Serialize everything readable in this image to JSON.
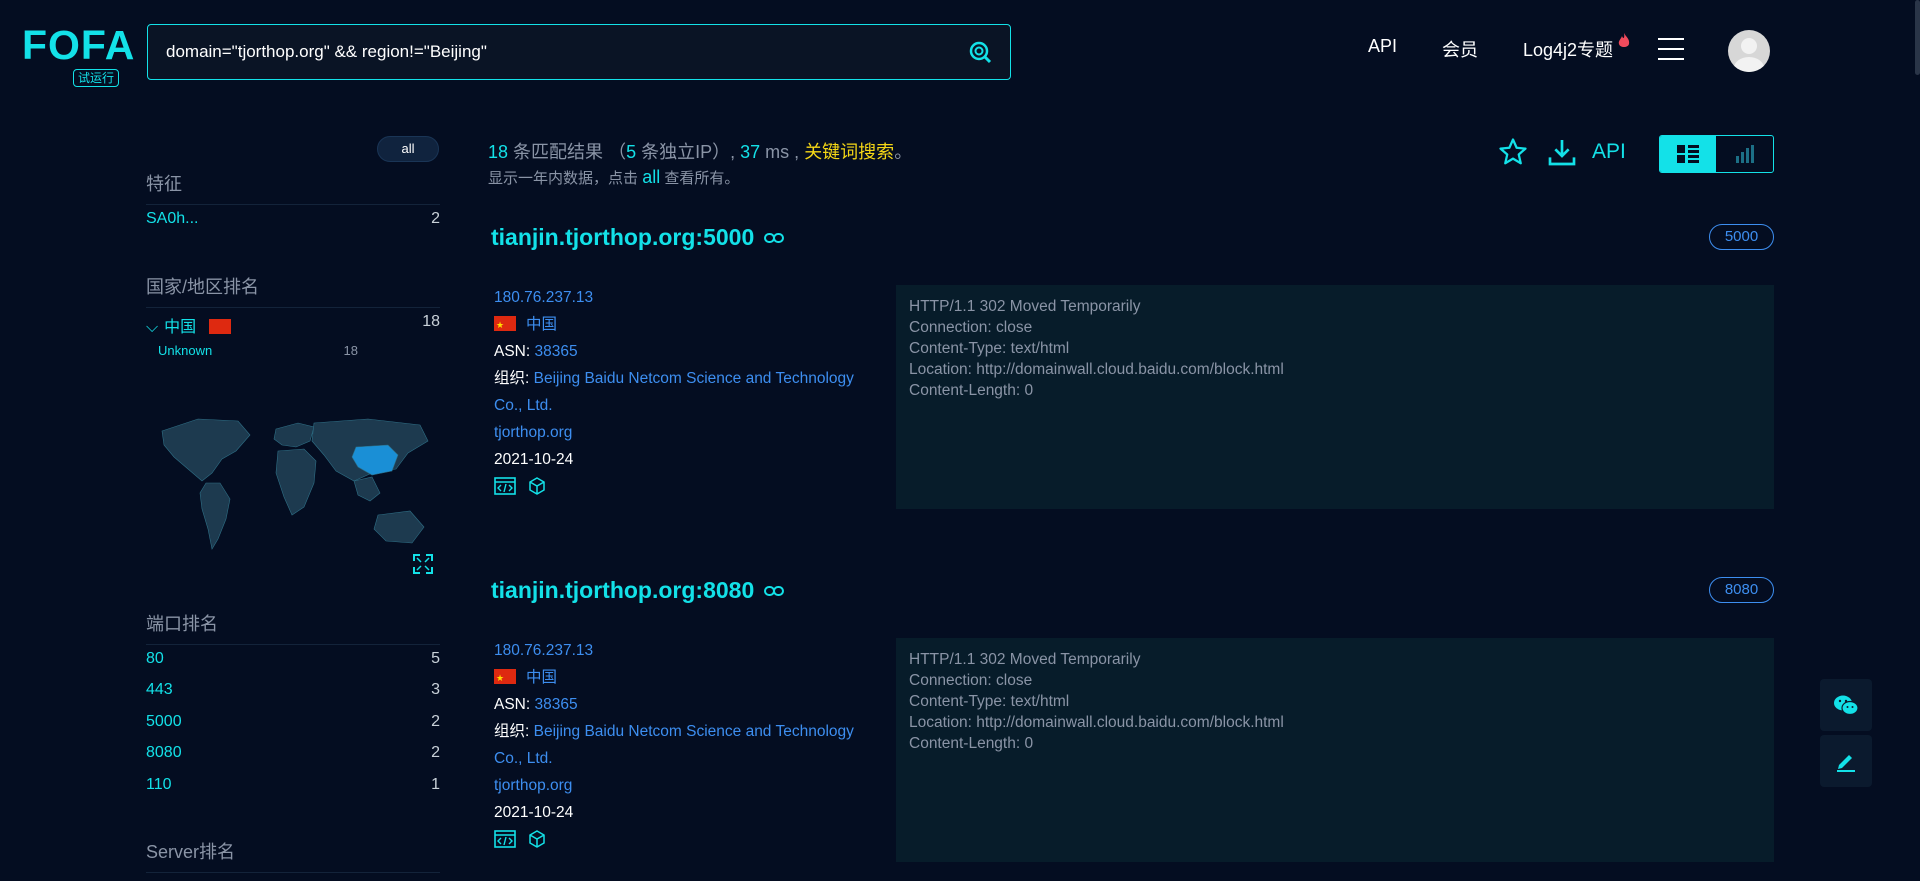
{
  "header": {
    "logo_text": "FOFA",
    "logo_badge": "试运行",
    "search_value": "domain=\"tjorthop.org\" && region!=\"Beijing\"",
    "nav": {
      "api": "API",
      "member": "会员",
      "log4j2": "Log4j2专题"
    }
  },
  "sidebar": {
    "all_label": "all",
    "feature_head": "特征",
    "features": [
      {
        "k": "SA0h...",
        "v": "2"
      }
    ],
    "country_head": "国家/地区排名",
    "country": {
      "name": "中国",
      "count": "18"
    },
    "region": {
      "name": "Unknown",
      "count": "18"
    },
    "port_head": "端口排名",
    "ports": [
      {
        "k": "80",
        "v": "5"
      },
      {
        "k": "443",
        "v": "3"
      },
      {
        "k": "5000",
        "v": "2"
      },
      {
        "k": "8080",
        "v": "2"
      },
      {
        "k": "110",
        "v": "1"
      }
    ],
    "server_head": "Server排名"
  },
  "summary": {
    "count": "18",
    "count_text": "条匹配结果",
    "ip_open": "（",
    "ip_count": "5",
    "ip_text": "条独立IP）,",
    "ms": "37",
    "ms_text": "ms ,",
    "keyword": "关键词搜索",
    "end": "。",
    "sub_pre": "显示一年内数据，点击",
    "sub_all": "all",
    "sub_post": "查看所有。"
  },
  "tools": {
    "api": "API"
  },
  "results": [
    {
      "title": "tianjin.tjorthop.org:5000",
      "port": "5000",
      "ip": "180.76.237.13",
      "country": "中国",
      "asn_label": "ASN:",
      "asn": "38365",
      "org_label": "组织:",
      "org": "Beijing Baidu Netcom Science and Technology Co., Ltd.",
      "domain": "tjorthop.org",
      "date": "2021-10-24",
      "banner": "HTTP/1.1 302 Moved Temporarily\nConnection: close\nContent-Type: text/html\nLocation: http://domainwall.cloud.baidu.com/block.html\nContent-Length: 0"
    },
    {
      "title": "tianjin.tjorthop.org:8080",
      "port": "8080",
      "ip": "180.76.237.13",
      "country": "中国",
      "asn_label": "ASN:",
      "asn": "38365",
      "org_label": "组织:",
      "org": "Beijing Baidu Netcom Science and Technology Co., Ltd.",
      "domain": "tjorthop.org",
      "date": "2021-10-24",
      "banner": "HTTP/1.1 302 Moved Temporarily\nConnection: close\nContent-Type: text/html\nLocation: http://domainwall.cloud.baidu.com/block.html\nContent-Length: 0"
    }
  ],
  "colors": {
    "accent": "#13e1e8",
    "link": "#3d8ef0",
    "keyword": "#f5d716",
    "background": "#040d21"
  }
}
